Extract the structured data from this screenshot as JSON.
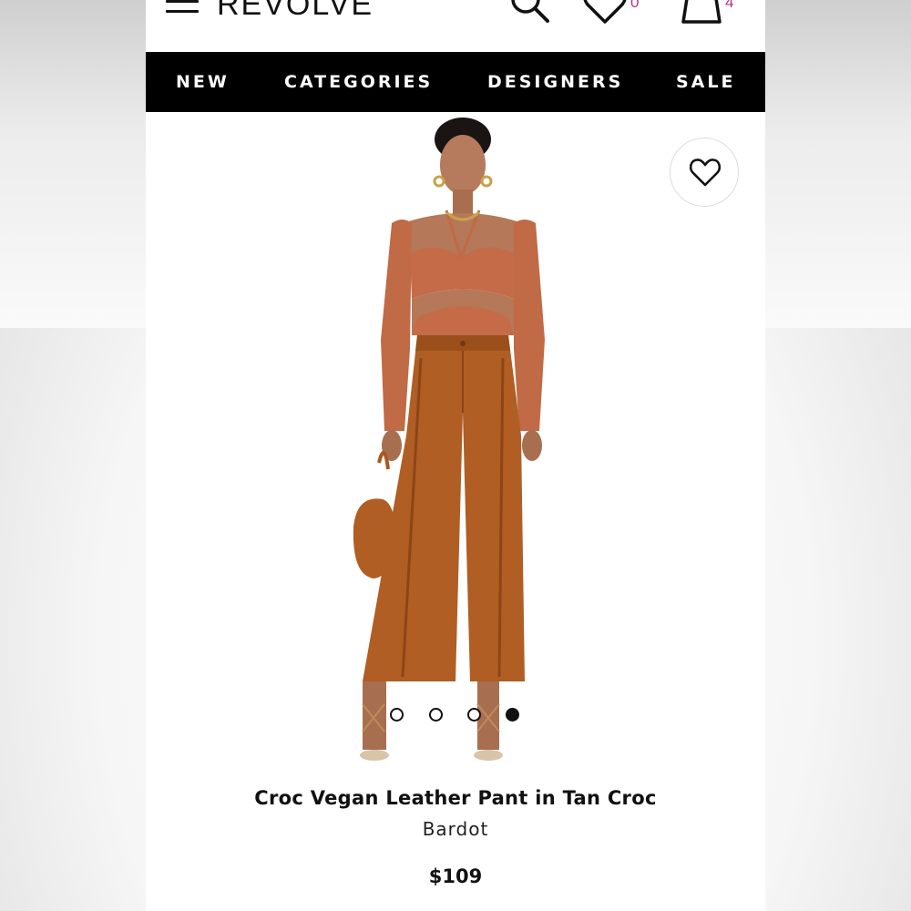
{
  "header": {
    "logo_text": "REVOLVE",
    "wishlist_count": "0",
    "bag_count": "4",
    "icons": [
      "menu-icon",
      "search-icon",
      "heart-icon",
      "shopping-bag-icon"
    ]
  },
  "nav": {
    "items": [
      {
        "label": "NEW"
      },
      {
        "label": "CATEGORIES"
      },
      {
        "label": "DESIGNERS"
      },
      {
        "label": "SALE"
      }
    ]
  },
  "gallery": {
    "slide_count": 4,
    "active_slide": 4
  },
  "product": {
    "title": "Croc Vegan Leather Pant in Tan Croc",
    "brand": "Bardot",
    "price": "$109"
  },
  "colors": {
    "nav_background": "#000000",
    "count_badge": "#b3338f"
  }
}
